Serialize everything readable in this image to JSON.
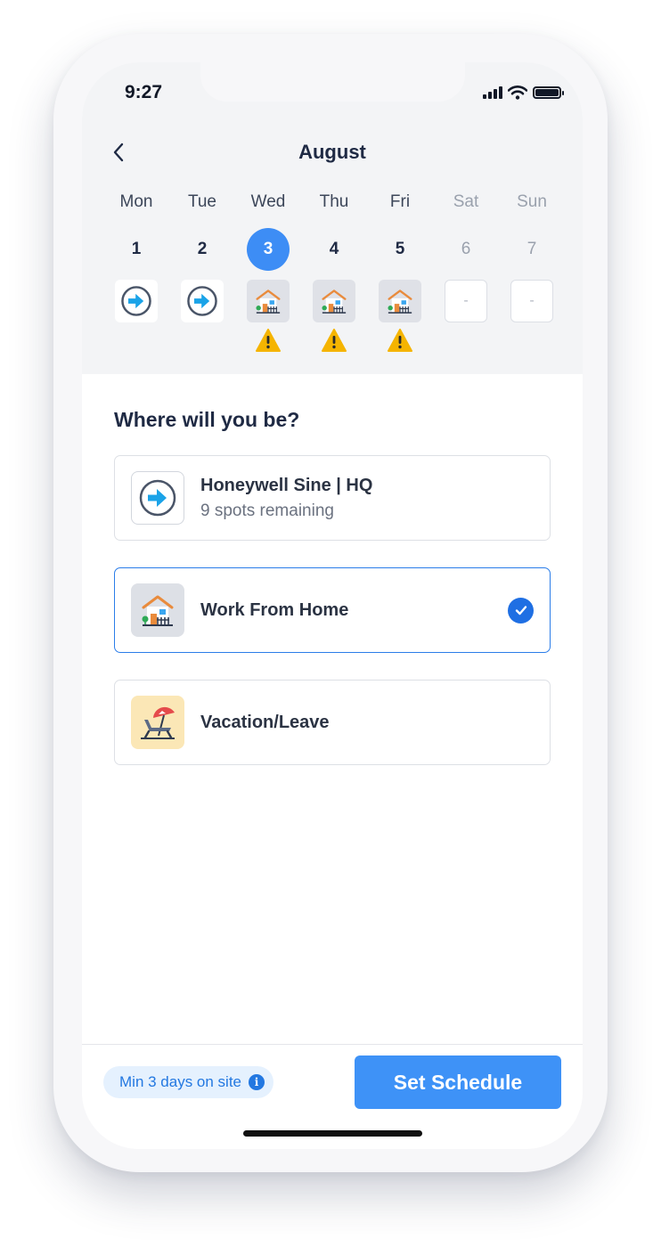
{
  "status": {
    "time": "9:27"
  },
  "header": {
    "month": "August"
  },
  "week": [
    {
      "name": "Mon",
      "num": "1",
      "location": "office",
      "warning": false,
      "weekend": false,
      "selected": false
    },
    {
      "name": "Tue",
      "num": "2",
      "location": "office",
      "warning": false,
      "weekend": false,
      "selected": false
    },
    {
      "name": "Wed",
      "num": "3",
      "location": "home",
      "warning": true,
      "weekend": false,
      "selected": true
    },
    {
      "name": "Thu",
      "num": "4",
      "location": "home",
      "warning": true,
      "weekend": false,
      "selected": false
    },
    {
      "name": "Fri",
      "num": "5",
      "location": "home",
      "warning": true,
      "weekend": false,
      "selected": false
    },
    {
      "name": "Sat",
      "num": "6",
      "location": "empty",
      "empty_label": "-",
      "warning": false,
      "weekend": true,
      "selected": false
    },
    {
      "name": "Sun",
      "num": "7",
      "location": "empty",
      "empty_label": "-",
      "warning": false,
      "weekend": true,
      "selected": false
    }
  ],
  "question": "Where will you be?",
  "options": [
    {
      "title": "Honeywell Sine | HQ",
      "subtitle": "9 spots remaining",
      "icon": "office-arrow-icon",
      "selected": false
    },
    {
      "title": "Work From Home",
      "icon": "house-icon",
      "selected": true
    },
    {
      "title": "Vacation/Leave",
      "icon": "beach-chair-icon",
      "selected": false
    }
  ],
  "footer": {
    "requirement": "Min 3 days on site",
    "info_glyph": "i",
    "button": "Set Schedule"
  },
  "colors": {
    "accent": "#3e92f7",
    "selected_border": "#2b7de9",
    "warning": "#f5b400",
    "office_icon": "#1aa3e8"
  }
}
